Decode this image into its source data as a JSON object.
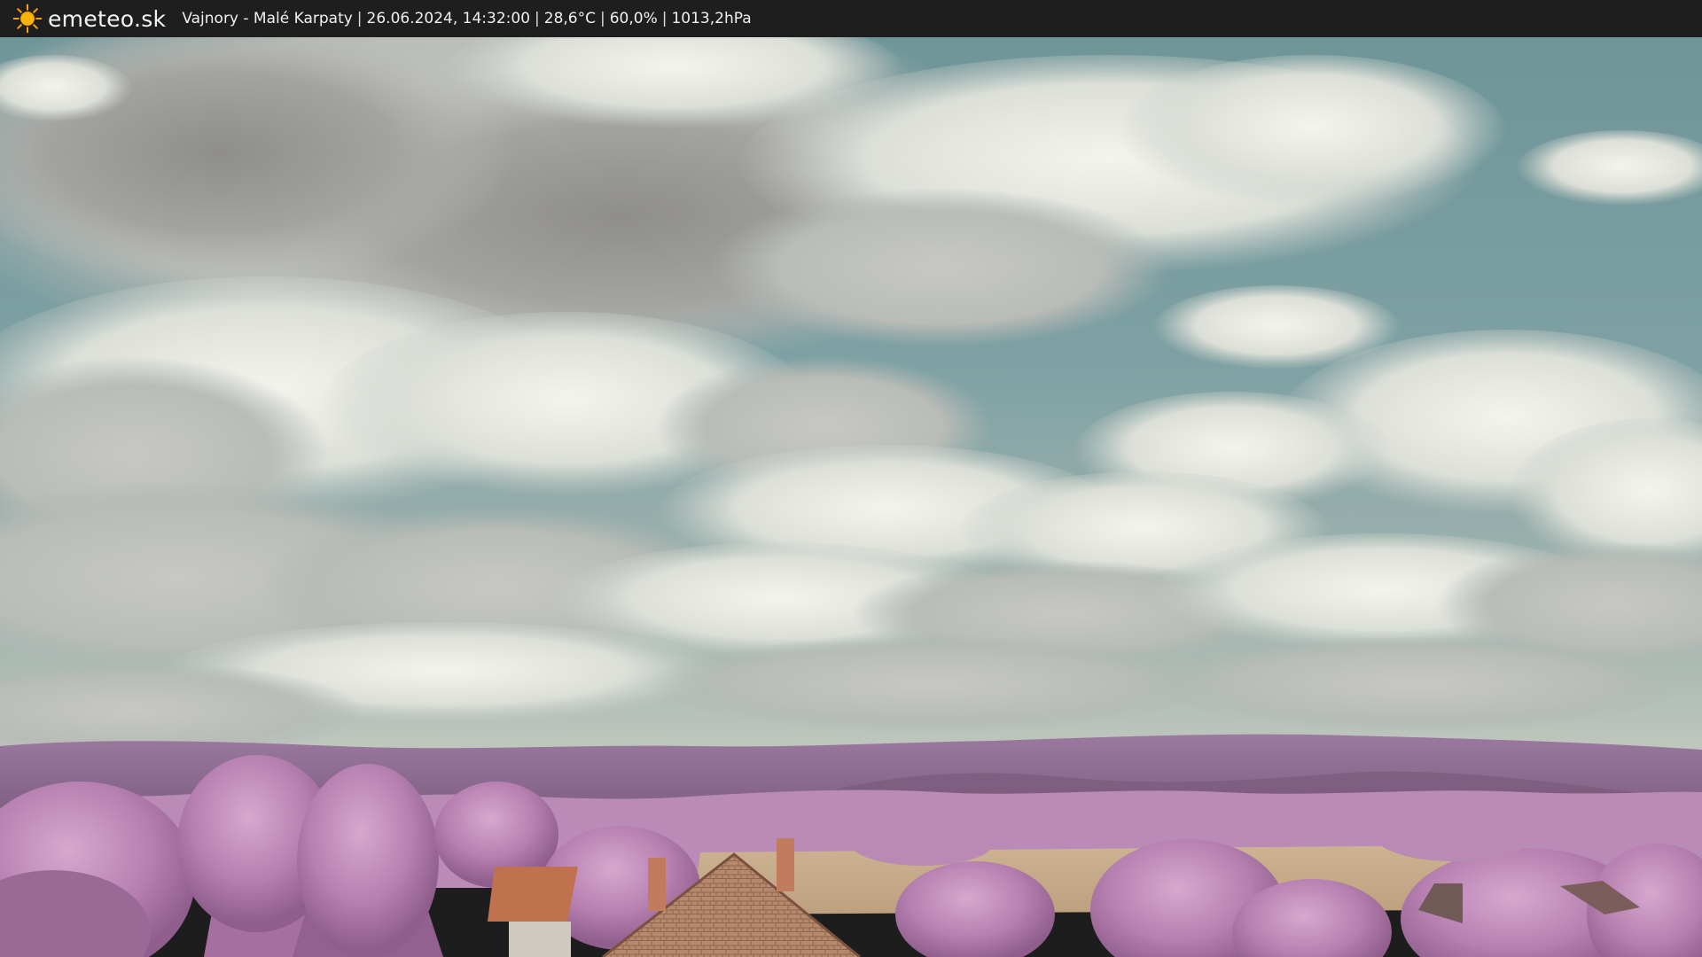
{
  "header": {
    "brand": "emeteo.sk",
    "logo_icon": "sun-icon",
    "location": "Vajnory - Malé Karpaty",
    "datetime": "26.06.2024, 14:32:00",
    "temperature": "28,6°C",
    "humidity": "60,0%",
    "pressure": "1013,2hPa",
    "separator": "|"
  },
  "colors": {
    "bar_background": "#1e1e1e",
    "sun": "#f5a300",
    "sky": "#7e9fa2",
    "clouds": "#e4e5df",
    "foliage": "#b985b4",
    "hills": "#8c6a91",
    "field": "#c9aa8a",
    "roof": "#c0724f"
  },
  "scene": {
    "description_icon": "webcam-landscape"
  }
}
